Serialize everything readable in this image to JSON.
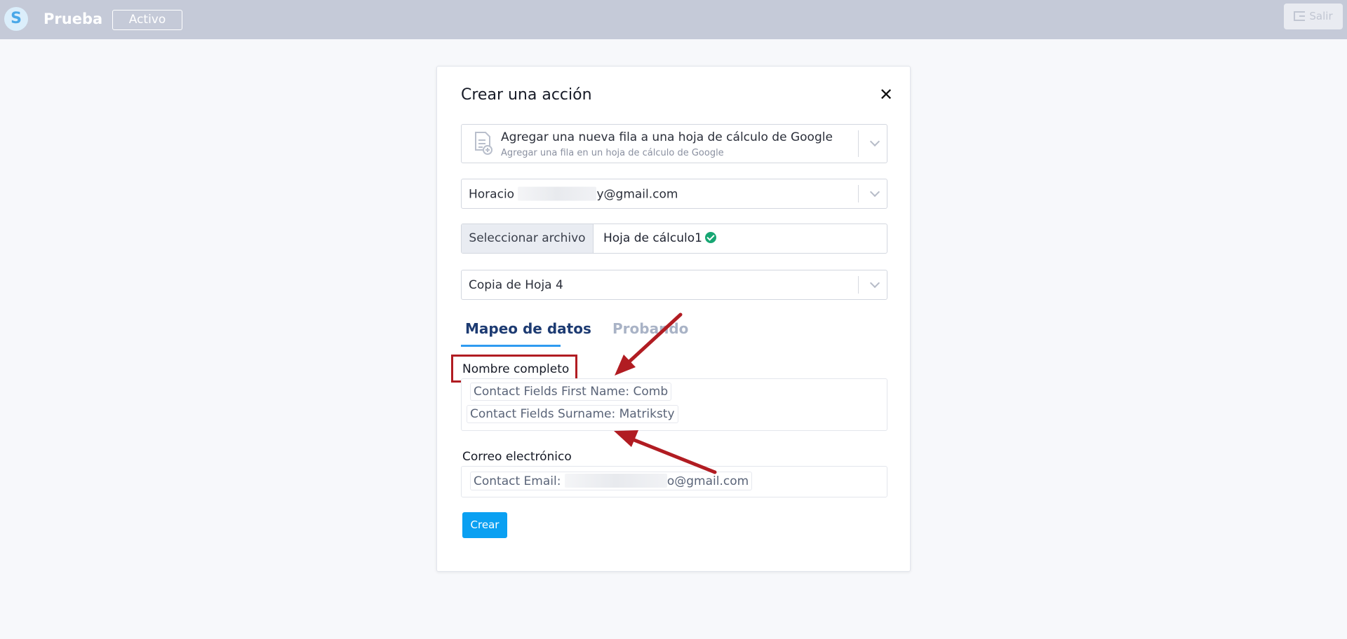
{
  "header": {
    "logo_letter": "S",
    "app_title": "Prueba",
    "status_label": "Activo",
    "logout_label": "Salir"
  },
  "modal": {
    "title": "Crear una acción",
    "close_symbol": "✕",
    "action_select": {
      "value": "Agregar una nueva fila a una hoja de cálculo de Google",
      "description": "Agregar una fila en un hoja de cálculo de Google"
    },
    "account_select": {
      "value_prefix": "Horacio",
      "value_suffix": "y@gmail.com"
    },
    "file_picker": {
      "button_label": "Seleccionar archivo",
      "file_name": "Hoja de cálculo1"
    },
    "sheet_select": {
      "value": "Copia de Hoja 4"
    },
    "tabs": [
      {
        "label": "Mapeo de datos",
        "active": true
      },
      {
        "label": "Probando",
        "active": false
      }
    ],
    "fields": [
      {
        "label": "Nombre completo",
        "chips": [
          "Contact Fields First Name: Comb",
          "Contact Fields Surname: Matriksty"
        ]
      },
      {
        "label": "Correo electrónico",
        "chip_prefix": "Contact Email:",
        "chip_suffix": "o@gmail.com"
      }
    ],
    "submit_label": "Crear"
  },
  "colors": {
    "topbar": "#c5cad8",
    "accent": "#0aa0f2",
    "tab_active": "#1d3b72",
    "annotation_red": "#b11c22",
    "success": "#17a673"
  },
  "icons": [
    "logo-icon",
    "logout-icon",
    "close-icon",
    "sheet-document-icon",
    "chevron-down-icon",
    "check-circle-icon"
  ]
}
